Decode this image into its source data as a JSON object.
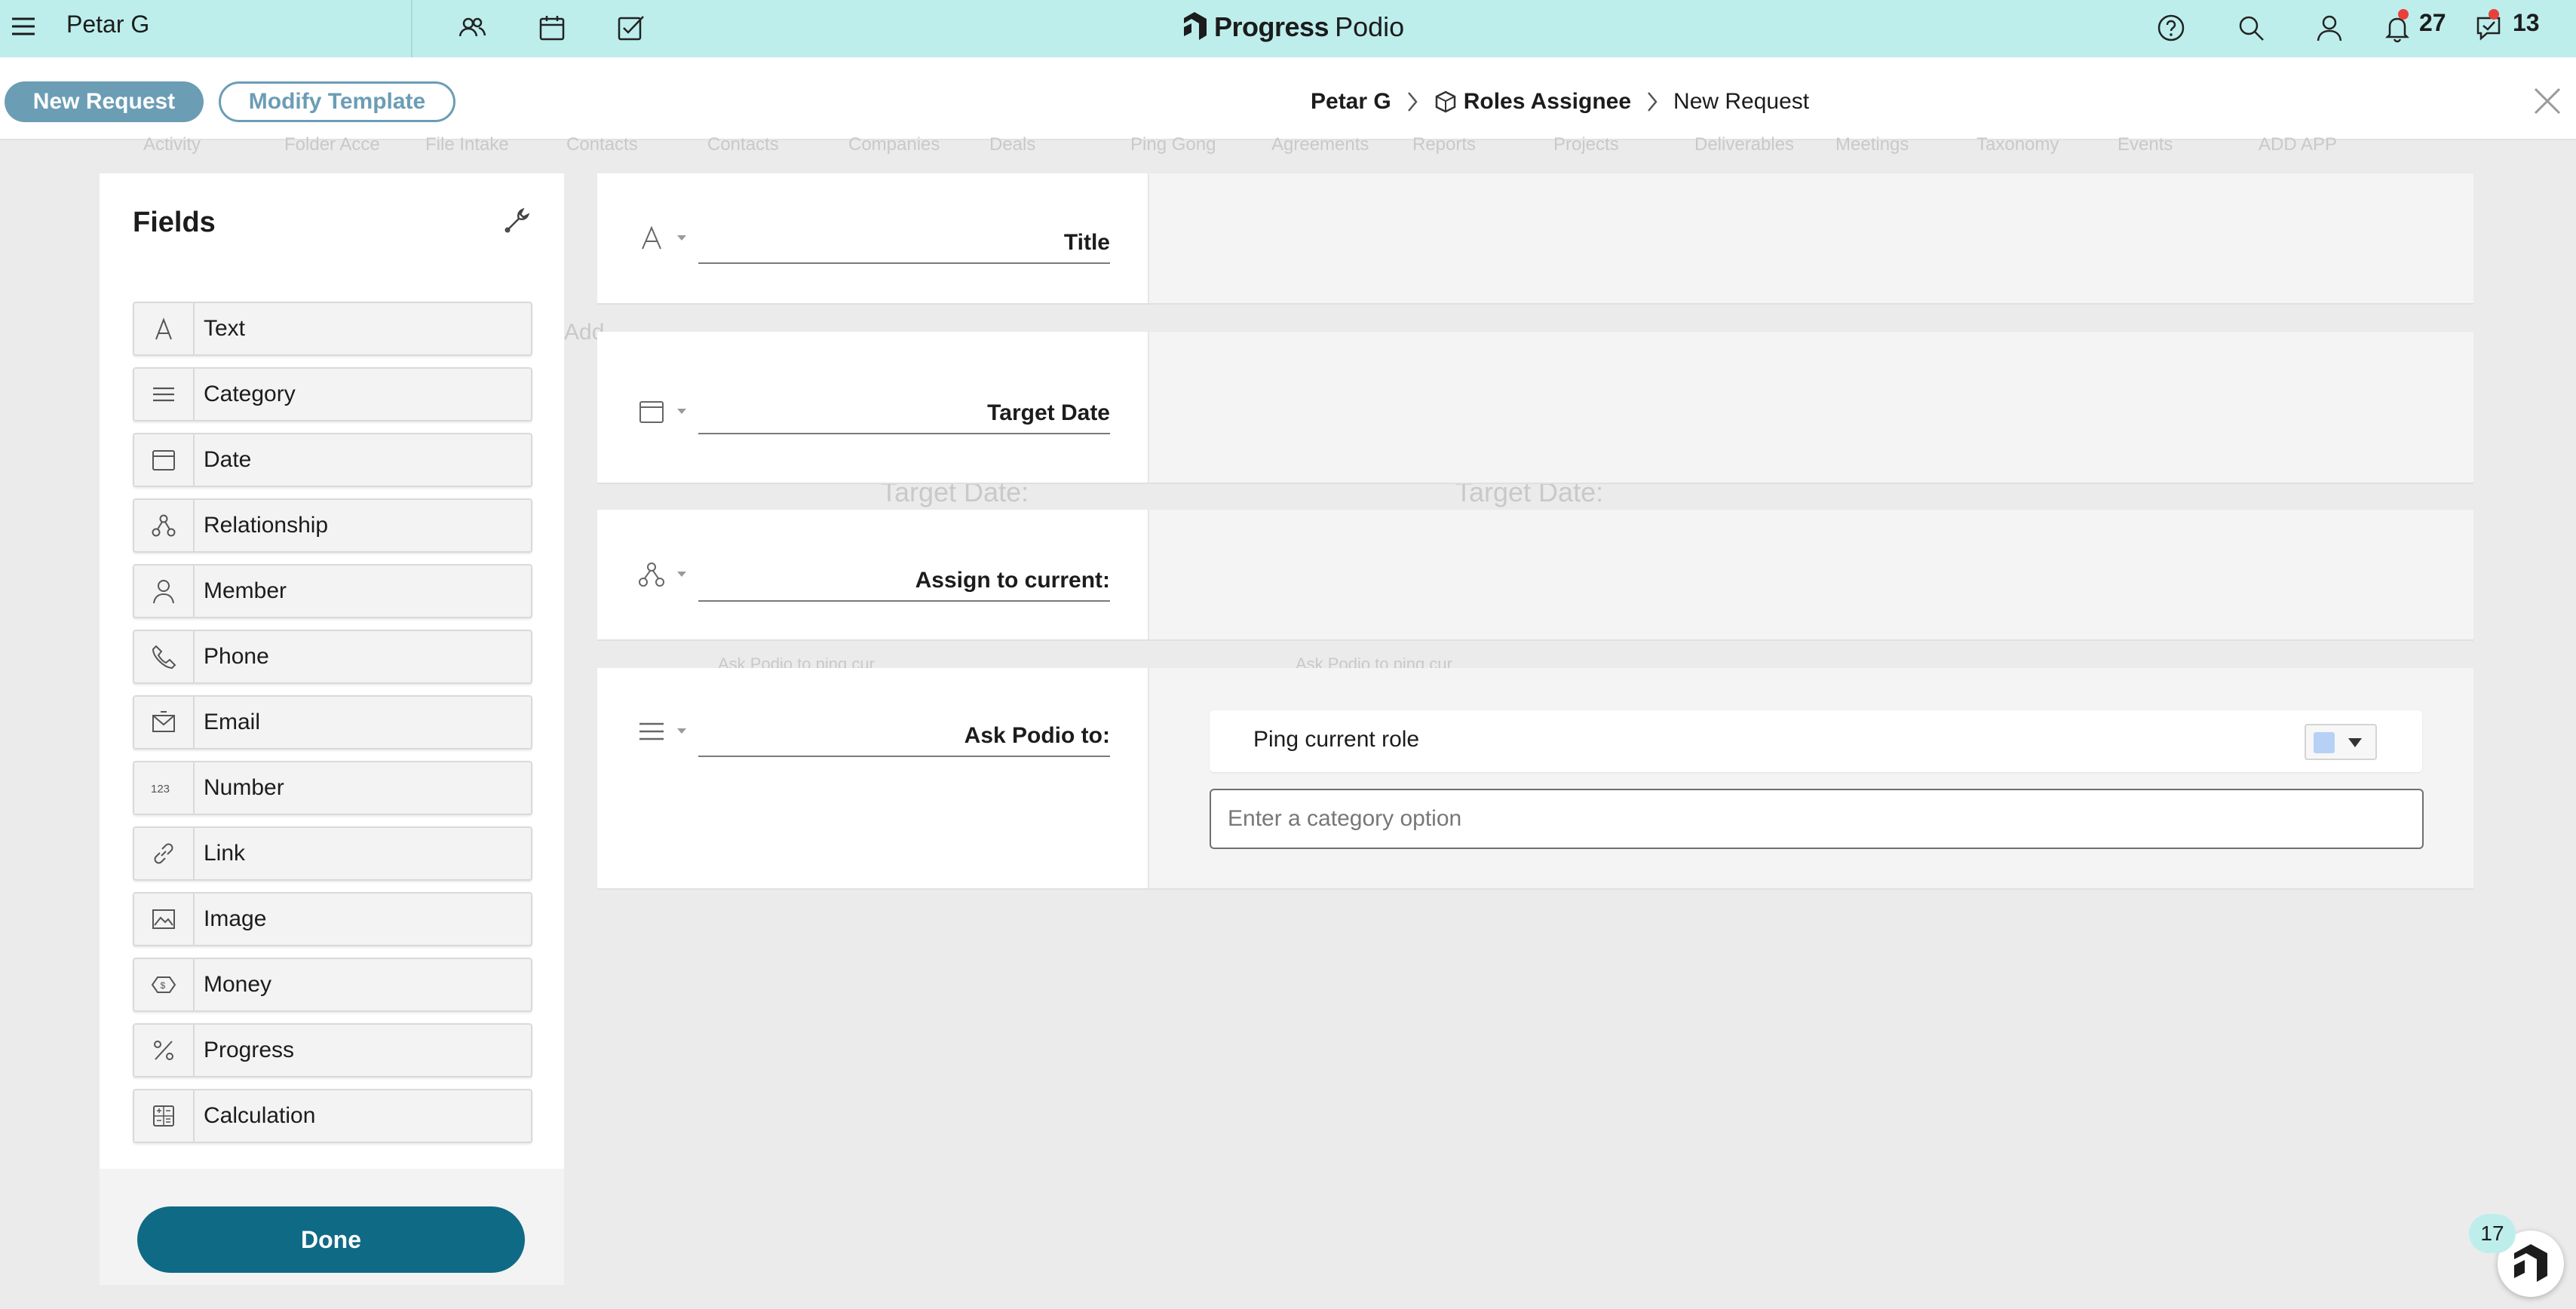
{
  "topbar": {
    "workspace_name": "Petar G",
    "brand": "Progress",
    "product": "Podio",
    "notifications_count": "27",
    "chats_count": "13"
  },
  "header": {
    "new_request_label": "New Request",
    "modify_template_label": "Modify Template",
    "breadcrumb": [
      "Petar G",
      "Roles Assignee",
      "New Request"
    ]
  },
  "fields_panel": {
    "title": "Fields",
    "items": [
      {
        "label": "Text",
        "icon": "text-icon"
      },
      {
        "label": "Category",
        "icon": "category-icon"
      },
      {
        "label": "Date",
        "icon": "date-icon"
      },
      {
        "label": "Relationship",
        "icon": "relationship-icon"
      },
      {
        "label": "Member",
        "icon": "member-icon"
      },
      {
        "label": "Phone",
        "icon": "phone-icon"
      },
      {
        "label": "Email",
        "icon": "email-icon"
      },
      {
        "label": "Number",
        "icon": "number-icon"
      },
      {
        "label": "Link",
        "icon": "link-icon"
      },
      {
        "label": "Image",
        "icon": "image-icon"
      },
      {
        "label": "Money",
        "icon": "money-icon"
      },
      {
        "label": "Progress",
        "icon": "progress-icon"
      },
      {
        "label": "Calculation",
        "icon": "calculation-icon"
      }
    ],
    "done_label": "Done"
  },
  "form": {
    "rows": [
      {
        "label": "Title",
        "type_icon": "text-icon"
      },
      {
        "label": "Target Date",
        "type_icon": "date-icon"
      },
      {
        "label": "Assign to current:",
        "type_icon": "relationship-icon"
      },
      {
        "label": "Ask Podio to:",
        "type_icon": "category-icon"
      }
    ],
    "category_option_label": "Ping current role",
    "category_option_color": "#b7d0f5",
    "category_input_placeholder": "Enter a category option"
  },
  "background": {
    "tabs": [
      "Activity",
      "Folder Acce",
      "File Intake",
      "Contacts",
      "Contacts",
      "Companies",
      "Deals",
      "Ping Gong",
      "Agreements",
      "Reports",
      "Projects",
      "Deliverables",
      "Meetings",
      "Taxonomy",
      "Events",
      "ADD APP"
    ],
    "add_text": "Add",
    "target_date_a": "Target Date:",
    "target_date_b": "Target Date:",
    "ask_text_a": "Ask Podio to ping cur",
    "ask_text_b": "Ask Podio to ping cur"
  },
  "help_badge": {
    "count": "17"
  },
  "colors": {
    "topbar": "#bdeeec",
    "accent": "#6b9db5",
    "done": "#0f6a85"
  }
}
